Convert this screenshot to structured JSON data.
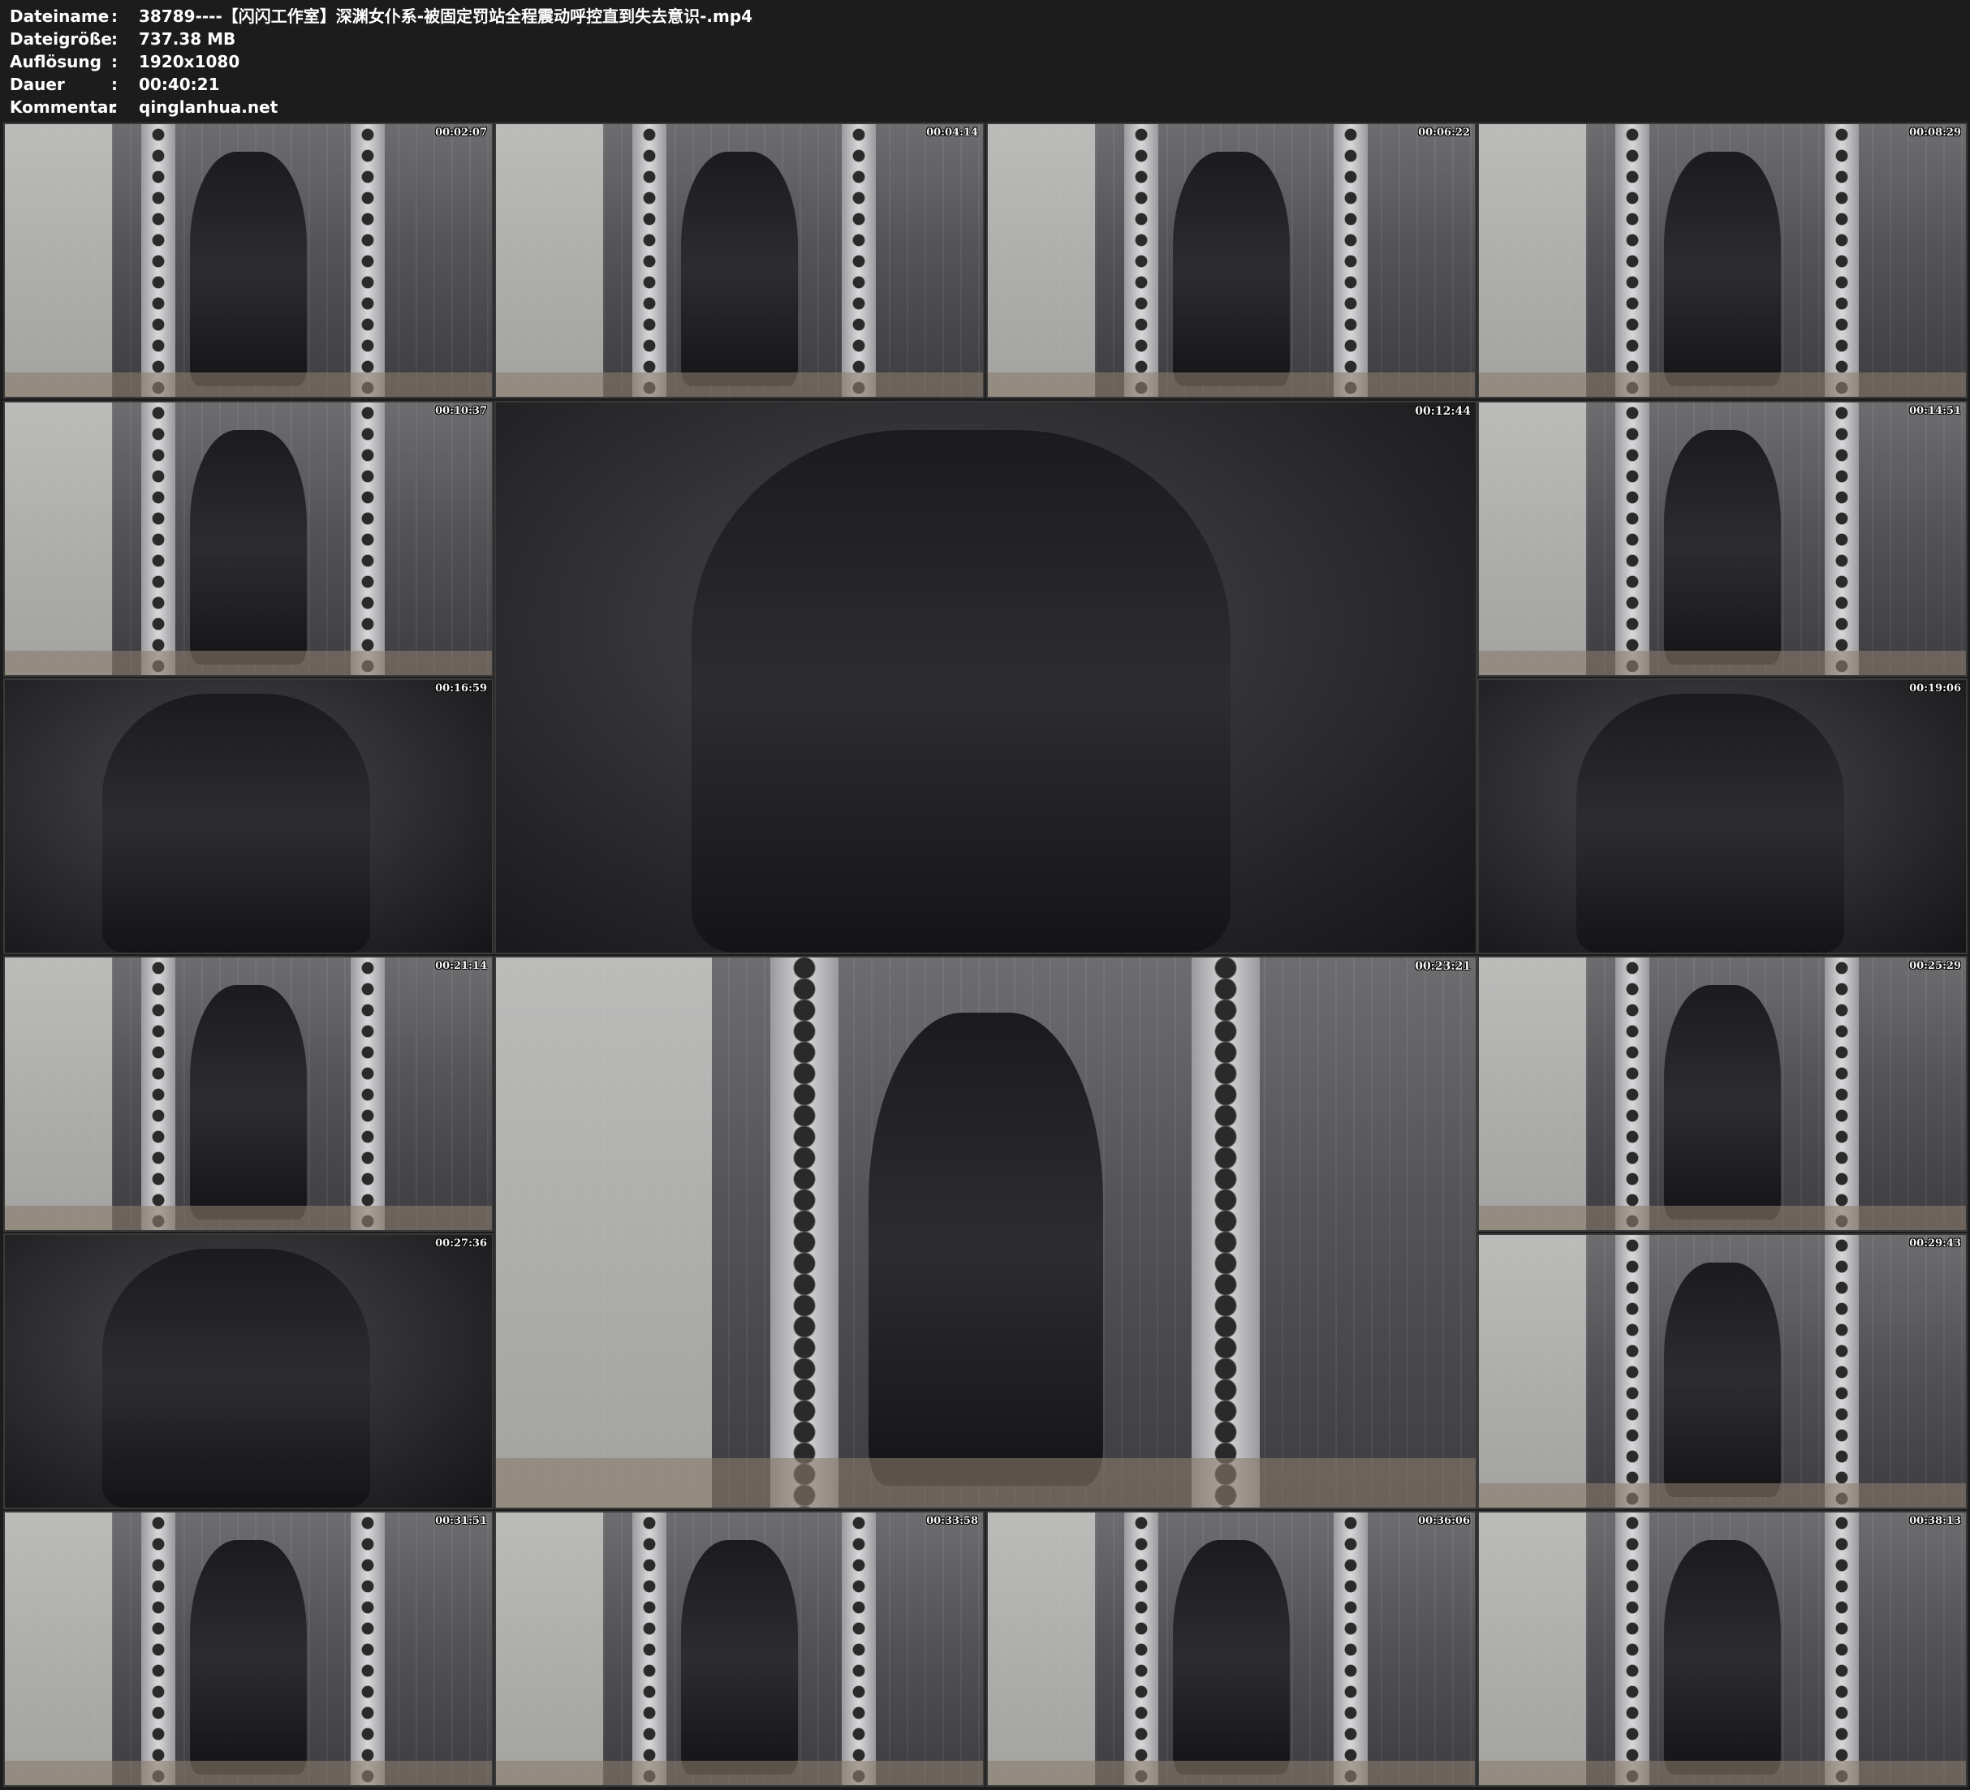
{
  "info": [
    {
      "label": "Dateiname",
      "value": "38789----【闪闪工作室】深渊女仆系-被固定罚站全程震动呼控直到失去意识-.mp4"
    },
    {
      "label": "Dateigröße",
      "value": "737.38 MB"
    },
    {
      "label": "Auflösung",
      "value": "1920x1080"
    },
    {
      "label": "Dauer",
      "value": "00:40:21"
    },
    {
      "label": "Kommentar",
      "value": "qinglanhua.net"
    }
  ],
  "separator": ":",
  "thumbnails": [
    {
      "timestamp": "00:02:07",
      "style": "room"
    },
    {
      "timestamp": "00:04:14",
      "style": "room"
    },
    {
      "timestamp": "00:06:22",
      "style": "room"
    },
    {
      "timestamp": "00:08:29",
      "style": "room"
    },
    {
      "timestamp": "00:10:37",
      "style": "room"
    },
    {
      "timestamp": "00:12:44",
      "style": "closeup"
    },
    {
      "timestamp": "00:14:51",
      "style": "room"
    },
    {
      "timestamp": "00:16:59",
      "style": "closeup"
    },
    {
      "timestamp": "00:19:06",
      "style": "closeup"
    },
    {
      "timestamp": "00:21:14",
      "style": "room"
    },
    {
      "timestamp": "00:23:21",
      "style": "room"
    },
    {
      "timestamp": "00:25:29",
      "style": "room"
    },
    {
      "timestamp": "00:27:36",
      "style": "closeup"
    },
    {
      "timestamp": "00:29:43",
      "style": "room"
    },
    {
      "timestamp": "00:31:51",
      "style": "room"
    },
    {
      "timestamp": "00:33:58",
      "style": "room"
    },
    {
      "timestamp": "00:36:06",
      "style": "room"
    },
    {
      "timestamp": "00:38:13",
      "style": "room"
    }
  ]
}
